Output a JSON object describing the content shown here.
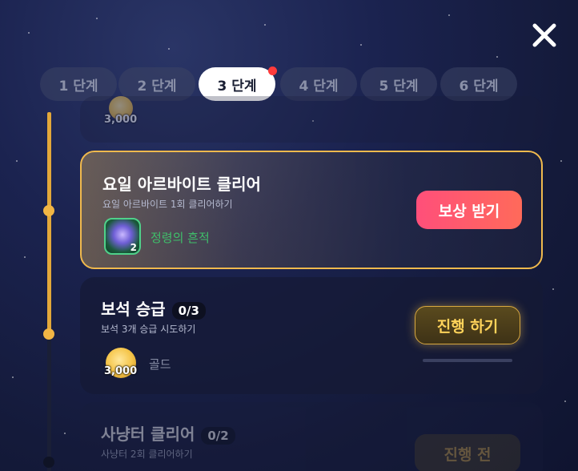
{
  "tabs": [
    {
      "label": "1 단계",
      "active": false
    },
    {
      "label": "2 단계",
      "active": false
    },
    {
      "label": "3 단계",
      "active": true,
      "has_notification": true
    },
    {
      "label": "4 단계",
      "active": false
    },
    {
      "label": "5 단계",
      "active": false
    },
    {
      "label": "6 단계",
      "active": false
    }
  ],
  "icons": {
    "close": "close-icon"
  },
  "previous_card": {
    "reward_amount": "3,000"
  },
  "missions": [
    {
      "title": "요일 아르바이트 클리어",
      "description": "요일 아르바이트 1회 클리어하기",
      "reward_name": "정령의 흔적",
      "reward_count": "2",
      "button_label": "보상 받기",
      "state": "claimable"
    },
    {
      "title": "보석 승급",
      "progress": "0/3",
      "description": "보석 3개 승급 시도하기",
      "reward_name": "골드",
      "reward_amount": "3,000",
      "button_label": "진행 하기",
      "state": "in_progress",
      "progress_fraction": 0
    },
    {
      "title": "사냥터 클리어",
      "progress": "0/2",
      "description": "사냥터 2회 클리어하기",
      "button_label": "진행 전",
      "state": "locked"
    }
  ],
  "colors": {
    "accent_gold": "#f0b94d",
    "claim_button": "#ff4f7a",
    "progress_text": "#ffd35a",
    "reward_green": "#3fbf6a"
  }
}
